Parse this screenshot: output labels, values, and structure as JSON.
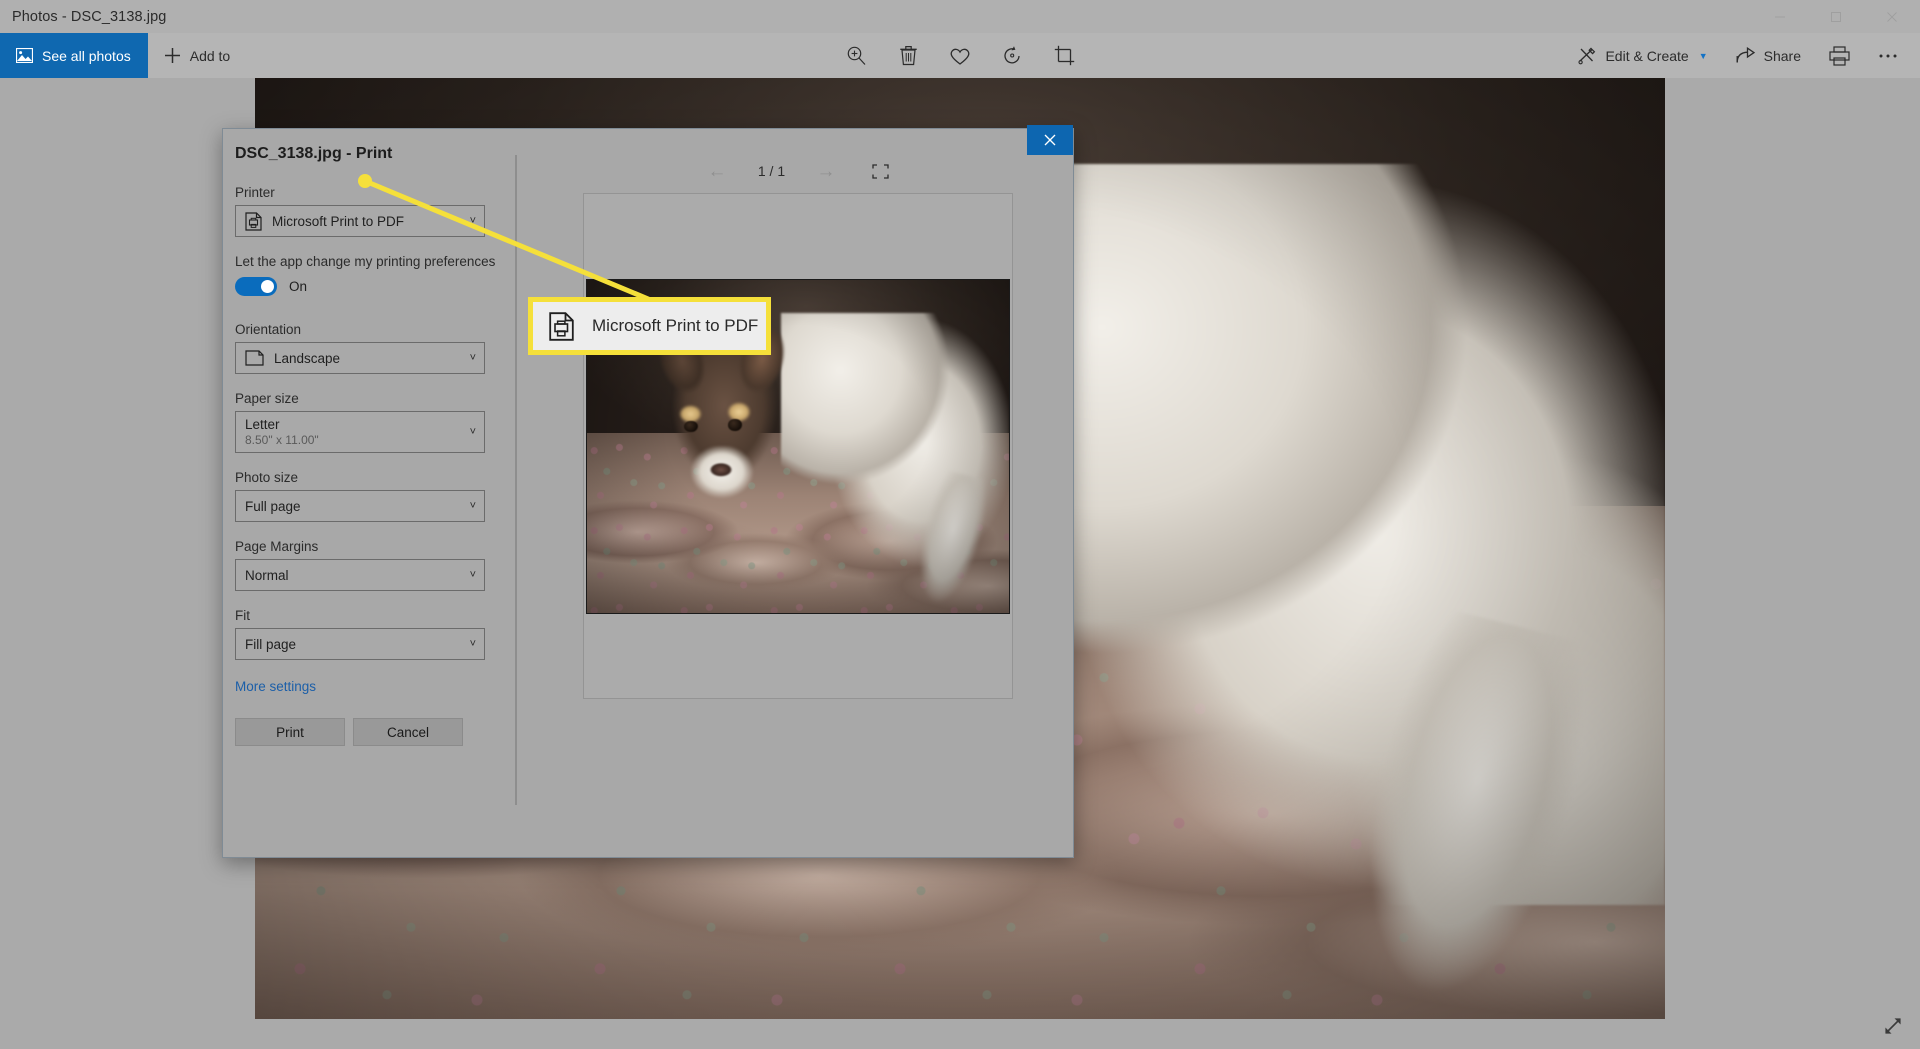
{
  "window": {
    "title": "Photos - DSC_3138.jpg",
    "controls": [
      {
        "name": "minimize",
        "glyph": "—"
      },
      {
        "name": "maximize",
        "glyph": "❐"
      },
      {
        "name": "close",
        "glyph": "✕"
      }
    ]
  },
  "command_bar": {
    "see_all_photos": "See all photos",
    "add_to": "Add to",
    "center_tools": [
      {
        "name": "zoom-icon",
        "title": "Zoom"
      },
      {
        "name": "delete-icon",
        "title": "Delete"
      },
      {
        "name": "favorite-heart-icon",
        "title": "Add to favorites"
      },
      {
        "name": "rotate-icon",
        "title": "Rotate"
      },
      {
        "name": "crop-icon",
        "title": "Crop & rotate"
      }
    ],
    "edit_create": "Edit & Create",
    "share": "Share",
    "print_icon": "print-icon",
    "more_icon": "more-ellipsis-icon"
  },
  "dialog": {
    "title": "DSC_3138.jpg - Print",
    "close_label": "Close",
    "printer_label": "Printer",
    "printer_value": "Microsoft Print to PDF",
    "preferences_label": "Let the app change my printing preferences",
    "toggle_state": "On",
    "orientation_label": "Orientation",
    "orientation_value": "Landscape",
    "paper_size_label": "Paper size",
    "paper_size_value": "Letter",
    "paper_size_dimensions": "8.50\" x 11.00\"",
    "photo_size_label": "Photo size",
    "photo_size_value": "Full page",
    "page_margins_label": "Page Margins",
    "page_margins_value": "Normal",
    "fit_label": "Fit",
    "fit_value": "Fill page",
    "more_settings": "More settings",
    "print_button": "Print",
    "cancel_button": "Cancel",
    "preview": {
      "page_indicator": "1 / 1",
      "prev_arrow": "←",
      "next_arrow": "→",
      "fit_icon": "fit-to-screen-icon"
    }
  },
  "callout": {
    "label": "Microsoft Print to PDF",
    "icon": "print-to-pdf-icon",
    "border_color": "#f5e03a",
    "fill_color": "#ededed"
  },
  "colors": {
    "accent_blue": "#0f68b0",
    "toggle_on": "#0a6cbd",
    "link_blue": "#1c5fa8",
    "highlight_yellow": "#f5e03a",
    "chrome_gray": "#b5b5b5",
    "dialog_gray": "#a8a8a8"
  },
  "status": {
    "expand_icon": "expand-diagonal-icon"
  }
}
